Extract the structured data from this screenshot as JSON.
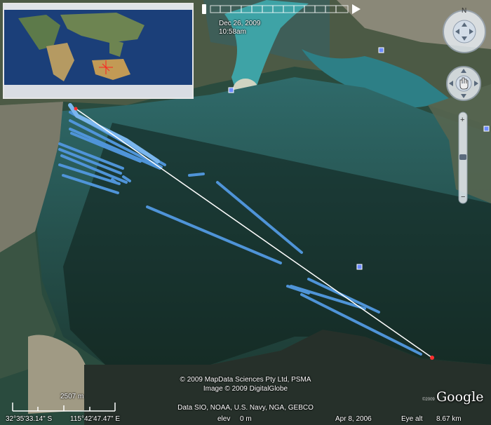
{
  "timeline": {
    "date": "Dec 26, 2009",
    "time": "10:58am"
  },
  "credits": {
    "line1": "© 2009 MapData Sciences Pty Ltd, PSMA",
    "line2": "Image © 2009 DigitalGlobe",
    "line3": "Data SIO, NOAA, U.S. Navy, NGA, GEBCO"
  },
  "scale": {
    "label": "2507 m"
  },
  "status": {
    "lat": "32°35'33.14\" S",
    "lon": "115°42'47.47\" E",
    "elev_label": "elev",
    "elev_value": "0 m",
    "date": "Apr 8, 2006",
    "eye_label": "Eye alt",
    "eye_value": "8.67 km"
  },
  "logo": {
    "text": "Google",
    "small": "©2009"
  },
  "icons": [
    "compass-north-icon",
    "look-joystick-icon",
    "move-joystick-icon",
    "zoom-in-icon",
    "zoom-out-icon",
    "placemark-icon"
  ],
  "colors": {
    "track": "#4f94d8",
    "track_light": "#7ab6ee",
    "line": "#ffffff",
    "water": "#1f3f3a"
  }
}
